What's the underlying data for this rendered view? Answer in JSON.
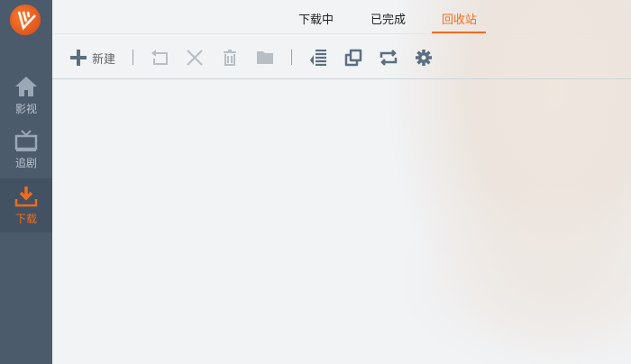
{
  "sidebar": {
    "items": [
      {
        "label": "影视",
        "icon": "home-icon"
      },
      {
        "label": "追剧",
        "icon": "tv-icon"
      },
      {
        "label": "下载",
        "icon": "download-icon",
        "active": true
      }
    ]
  },
  "tabs": [
    {
      "label": "下载中"
    },
    {
      "label": "已完成"
    },
    {
      "label": "回收站",
      "active": true
    }
  ],
  "toolbar": {
    "new_label": "新建"
  },
  "colors": {
    "accent": "#f26b1d",
    "sidebar": "#4b5b6c"
  }
}
